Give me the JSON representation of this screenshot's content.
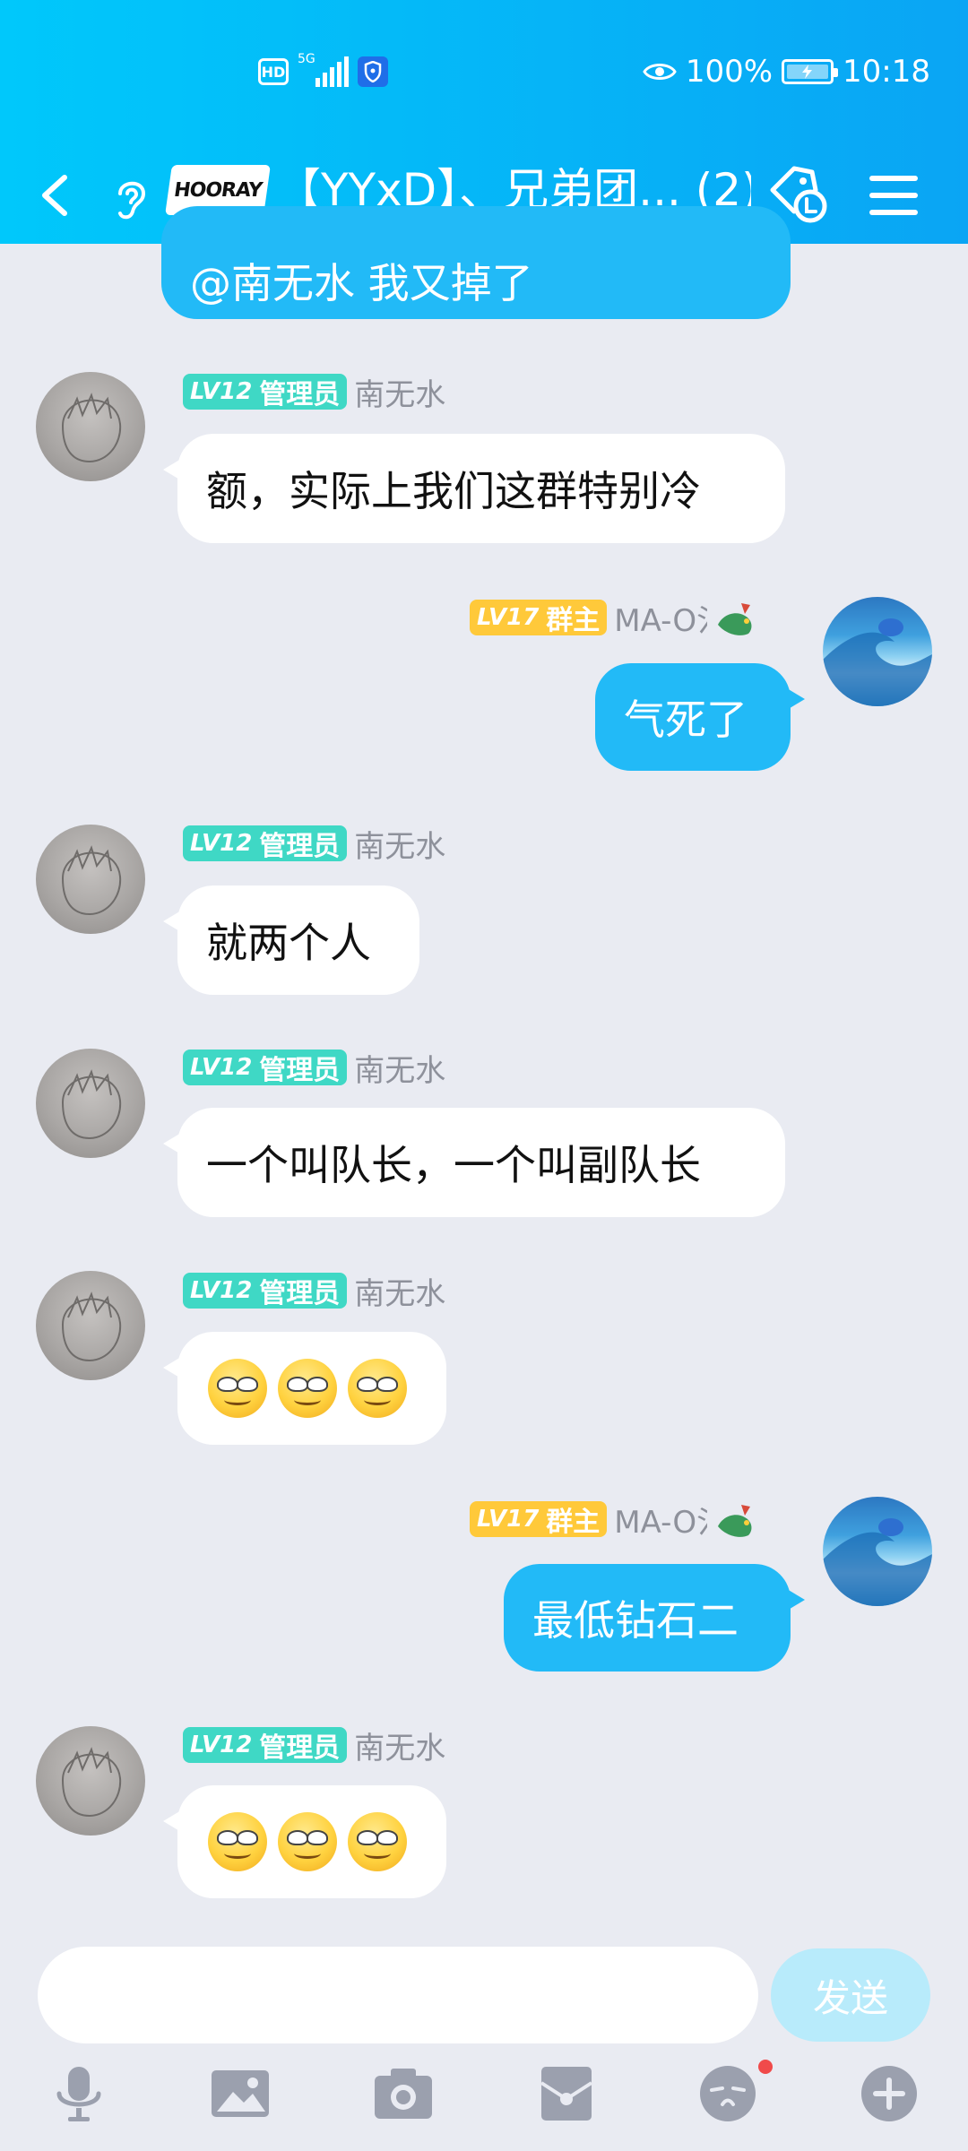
{
  "status_bar": {
    "hd": "HD",
    "network": "5G",
    "battery": "100%",
    "time": "10:18"
  },
  "nav": {
    "group_logo_text": "HOORAY",
    "title": "【YYxD】、兄弟团... (2)"
  },
  "messages": [
    {
      "side": "out",
      "text": "@南无水 我又掉了"
    },
    {
      "side": "in",
      "level": "LV12",
      "role": "管理员",
      "sender": "南无水",
      "text": "额，实际上我们这群特别冷"
    },
    {
      "side": "out",
      "level": "LV17",
      "role": "群主",
      "sender": "MA-O氵",
      "text": "气死了"
    },
    {
      "side": "in",
      "level": "LV12",
      "role": "管理员",
      "sender": "南无水",
      "text": "就两个人"
    },
    {
      "side": "in",
      "level": "LV12",
      "role": "管理员",
      "sender": "南无水",
      "text": "一个叫队长，一个叫副队长"
    },
    {
      "side": "in",
      "level": "LV12",
      "role": "管理员",
      "sender": "南无水",
      "emoji": [
        "smirk",
        "smirk",
        "smirk"
      ]
    },
    {
      "side": "out",
      "level": "LV17",
      "role": "群主",
      "sender": "MA-O氵",
      "text": "最低钻石二"
    },
    {
      "side": "in",
      "level": "LV12",
      "role": "管理员",
      "sender": "南无水",
      "emoji": [
        "smirk",
        "smirk",
        "smirk"
      ]
    }
  ],
  "input": {
    "placeholder": "",
    "send_label": "发送"
  },
  "toolbar": [
    "microphone-icon",
    "image-icon",
    "camera-icon",
    "red-packet-icon",
    "emoji-icon",
    "plus-icon"
  ],
  "colors": {
    "header_start": "#00c8fb",
    "header_end": "#0aa5f4",
    "bubble_out": "#22baf7",
    "bubble_in": "#ffffff",
    "background": "#e9ebf2",
    "badge_admin": "#3fd8c5",
    "badge_owner": "#ffc93a",
    "send_button": "#b8ebfb"
  }
}
